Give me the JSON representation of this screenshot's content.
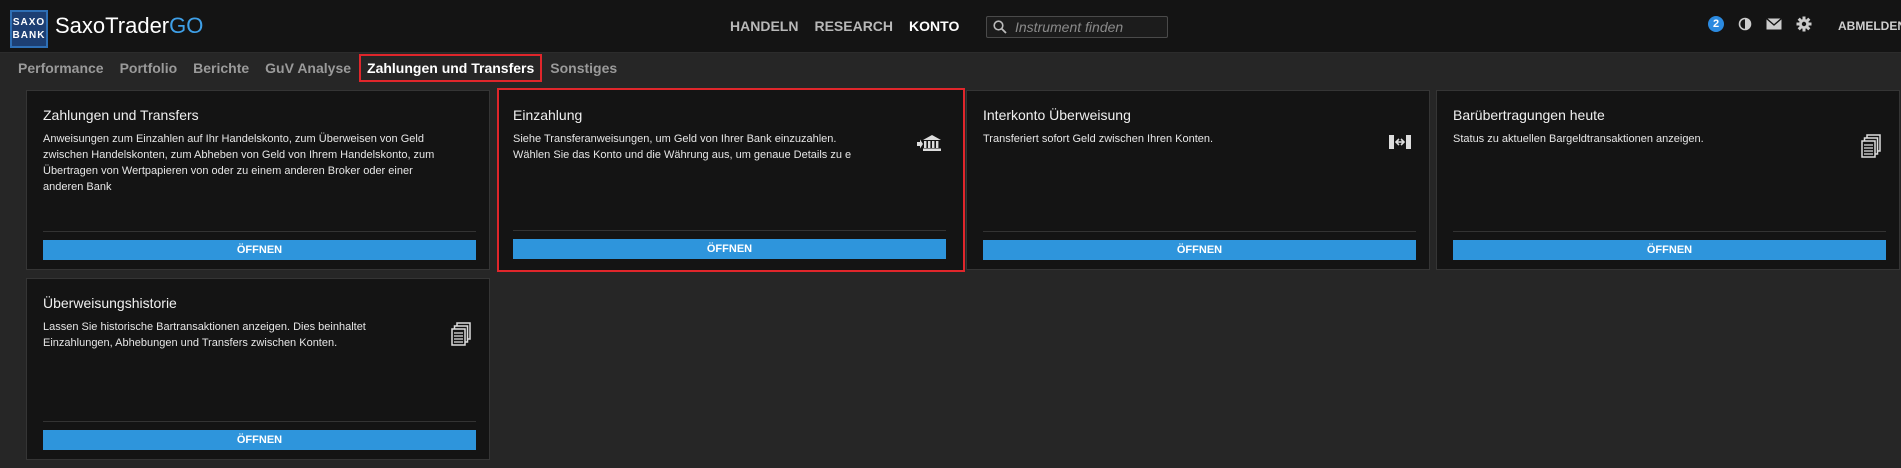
{
  "brand": {
    "logo_line1": "SAXO",
    "logo_line2": "BANK",
    "name": "SaxoTrader",
    "name_suffix": "GO"
  },
  "topnav": {
    "items": [
      "HANDELN",
      "RESEARCH",
      "KONTO"
    ],
    "active": "KONTO"
  },
  "search": {
    "placeholder": "Instrument finden"
  },
  "header_right": {
    "notification_count": "2",
    "logout_label": "ABMELDEN"
  },
  "subnav": {
    "items": [
      "Performance",
      "Portfolio",
      "Berichte",
      "GuV Analyse",
      "Zahlungen und Transfers",
      "Sonstiges"
    ],
    "active": "Zahlungen und Transfers"
  },
  "cards": [
    {
      "title": "Zahlungen und Transfers",
      "description": "Anweisungen zum Einzahlen auf Ihr Handelskonto, zum Überweisen von Geld\nzwischen Handelskonten, zum Abheben von Geld von Ihrem Handelskonto, zum\nÜbertragen von Wertpapieren von oder zu einem anderen Broker oder einer\nanderen Bank",
      "icon": "none",
      "button": "ÖFFNEN"
    },
    {
      "title": "Einzahlung",
      "description": "Siehe Transferanweisungen, um Geld von Ihrer Bank einzuzahlen.\nWählen Sie das Konto und die Währung aus, um genaue Details zu e",
      "icon": "bank-deposit-icon",
      "button": "ÖFFNEN"
    },
    {
      "title": "Interkonto Überweisung",
      "description": "Transferiert sofort Geld zwischen Ihren Konten.",
      "icon": "transfer-arrows-icon",
      "button": "ÖFFNEN"
    },
    {
      "title": "Barübertragungen heute",
      "description": "Status zu aktuellen Bargeldtransaktionen anzeigen.",
      "icon": "documents-icon",
      "button": "ÖFFNEN"
    },
    {
      "title": "Überweisungshistorie",
      "description": "Lassen Sie historische Bartransaktionen anzeigen. Dies beinhaltet\nEinzahlungen, Abhebungen und Transfers zwischen Konten.",
      "icon": "documents-icon",
      "button": "ÖFFNEN"
    }
  ],
  "colors": {
    "accent": "#2e95dc",
    "highlight": "#e0262b",
    "background": "#262626",
    "card": "#141414"
  }
}
